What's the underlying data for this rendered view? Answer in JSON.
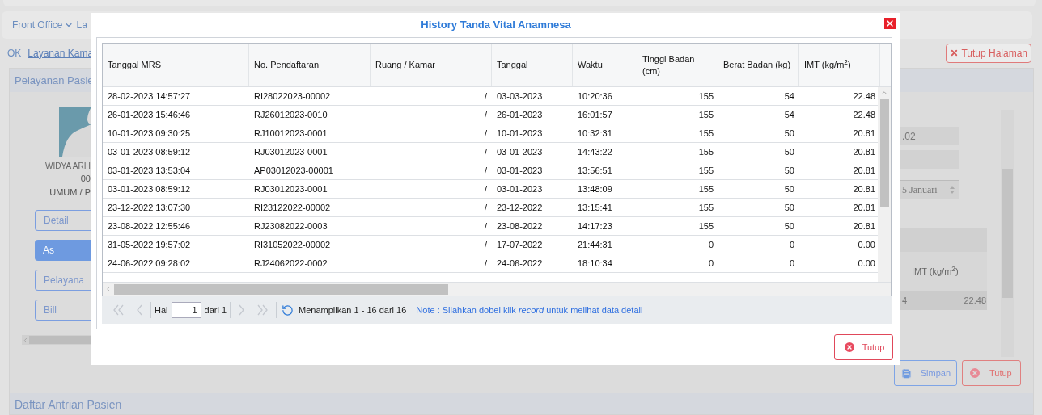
{
  "nav": {
    "items": [
      {
        "label": "Front Office",
        "has_menu": true
      },
      {
        "label": "La",
        "has_menu": false
      }
    ]
  },
  "breadcrumb": {
    "prefix": "OK",
    "link": "Layanan Kama"
  },
  "close_page_button": "Tutup Halaman",
  "panel": {
    "title": "Pelayanan Pasie",
    "patient": {
      "name": "WIDYA ARI I",
      "number": "00",
      "group": "UMUM / P"
    },
    "side_buttons": [
      {
        "label": "Detail",
        "selected": false
      },
      {
        "label": "As",
        "selected": true
      },
      {
        "label": "Pelayana",
        "selected": false
      },
      {
        "label": "Bill",
        "selected": false
      }
    ],
    "fields": [
      {
        "kind": "text",
        "value": ".02"
      },
      {
        "kind": "text"
      },
      {
        "kind": "date",
        "value": "5 Januari"
      }
    ],
    "vital_table": {
      "column": "IMT (kg/m$^{2}$)",
      "row": [
        "4",
        "22.48"
      ]
    },
    "buttons": [
      {
        "label": "Simpan",
        "kind": "save"
      },
      {
        "label": "Tutup",
        "kind": "close"
      }
    ]
  },
  "queue_title": "Daftar Antrian Pasien",
  "modal": {
    "title": "History Tanda Vital Anamnesa",
    "columns": [
      {
        "label": "Tanggal MRS",
        "kind": "text"
      },
      {
        "label": "No. Pendaftaran",
        "kind": "text"
      },
      {
        "label": "Ruang / Kamar",
        "kind": "number"
      },
      {
        "label": "Tanggal",
        "kind": "text"
      },
      {
        "label": "Waktu",
        "kind": "text"
      },
      {
        "label": "Tinggi Badan (cm)",
        "kind": "number"
      },
      {
        "label": "Berat Badan (kg)",
        "kind": "number"
      },
      {
        "label": "IMT (kg/m$^{2}$)",
        "kind": "number"
      }
    ],
    "rows": [
      [
        "28-02-2023 14:57:27",
        "RI28022023-00002",
        "/",
        "03-03-2023",
        "10:20:36",
        "155",
        "54",
        "22.48"
      ],
      [
        "26-01-2023 15:46:46",
        "RJ26012023-0010",
        "/",
        "26-01-2023",
        "16:01:57",
        "155",
        "54",
        "22.48"
      ],
      [
        "10-01-2023 09:30:25",
        "RJ10012023-0001",
        "/",
        "10-01-2023",
        "10:32:31",
        "155",
        "50",
        "20.81"
      ],
      [
        "03-01-2023 08:59:12",
        "RJ03012023-0001",
        "/",
        "03-01-2023",
        "14:43:22",
        "155",
        "50",
        "20.81"
      ],
      [
        "03-01-2023 13:53:04",
        "AP03012023-00001",
        "/",
        "03-01-2023",
        "13:56:51",
        "155",
        "50",
        "20.81"
      ],
      [
        "03-01-2023 08:59:12",
        "RJ03012023-0001",
        "/",
        "03-01-2023",
        "13:48:09",
        "155",
        "50",
        "20.81"
      ],
      [
        "23-12-2022 13:07:30",
        "RI23122022-00002",
        "/",
        "23-12-2022",
        "13:15:41",
        "155",
        "50",
        "20.81"
      ],
      [
        "23-08-2022 12:55:46",
        "RJ23082022-0003",
        "/",
        "23-08-2022",
        "14:17:23",
        "155",
        "50",
        "20.81"
      ],
      [
        "31-05-2022 19:57:02",
        "RI31052022-00002",
        "/",
        "17-07-2022",
        "21:44:31",
        "0",
        "0",
        "0.00"
      ],
      [
        "24-06-2022 09:28:02",
        "RJ24062022-0002",
        "/",
        "24-06-2022",
        "18:10:34",
        "0",
        "0",
        "0.00"
      ]
    ],
    "pager": {
      "buttons_before": [
        {
          "kind": "first",
          "disabled": true
        },
        {
          "kind": "prev",
          "disabled": true
        }
      ],
      "page_label": "Hal",
      "page": "1",
      "of": "dari 1",
      "buttons_after": [
        {
          "kind": "next",
          "disabled": true
        },
        {
          "kind": "last",
          "disabled": true
        }
      ],
      "summary": "Menampilkan 1 - 16 dari 16",
      "note": "Note : Silahkan dobel klik *record* untuk melihat data detail"
    },
    "close_button": "Tutup"
  }
}
